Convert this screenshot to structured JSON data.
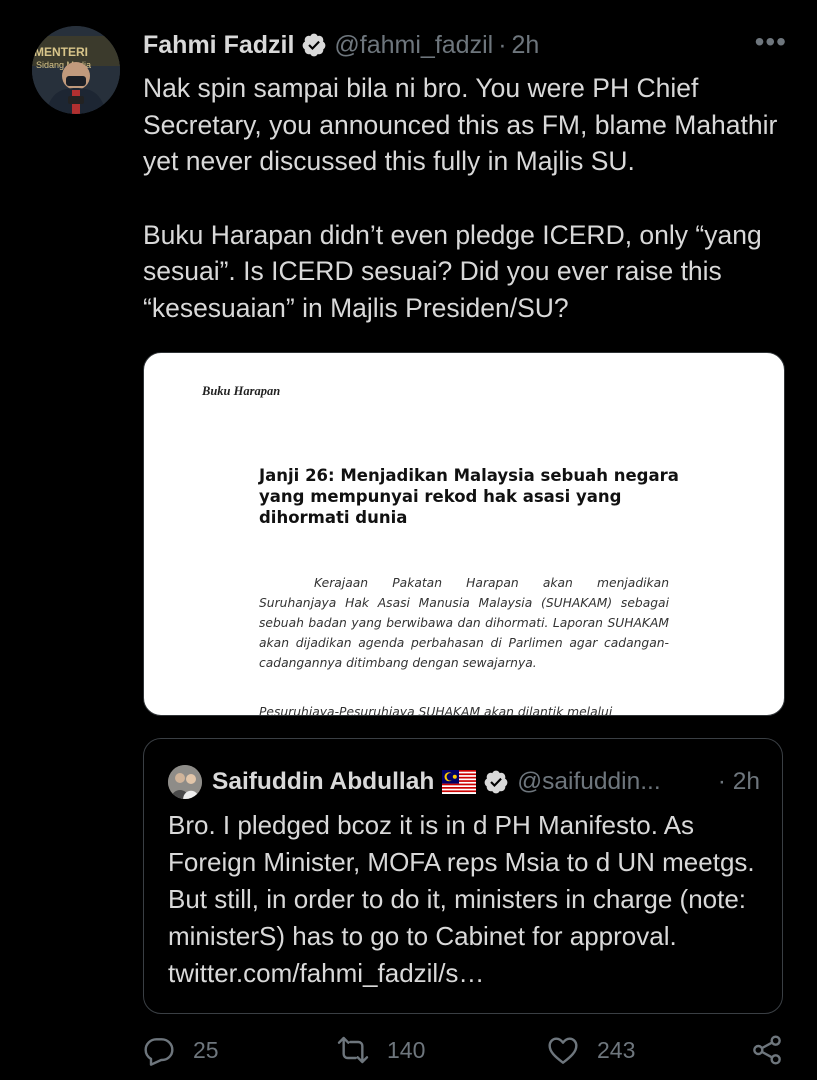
{
  "tweet": {
    "author_name": "Fahmi Fadzil",
    "handle": "@fahmi_fadzil",
    "separator": "·",
    "time": "2h",
    "more_label": "•••",
    "avatar_backdrop_text": "MENTERI",
    "avatar_backdrop_text2": "Sidang Media",
    "paragraphs": [
      "Nak spin sampai bila ni bro. You were PH Chief Secretary, you announced this as FM, blame Mahathir yet never discussed this fully in Majlis SU.",
      "Buku Harapan didn’t even pledge ICERD, only “yang sesuai”. Is ICERD sesuai? Did you ever raise this “kesesuaian” in Majlis Presiden/SU?"
    ]
  },
  "media": {
    "doc_label": "Buku Harapan",
    "heading": "Janji 26: Menjadikan Malaysia sebuah negara yang mempunyai rekod hak asasi yang dihormati dunia",
    "body": "Kerajaan Pakatan Harapan akan menjadikan Suruhanjaya Hak Asasi Manusia Malaysia (SUHAKAM) sebagai sebuah badan yang berwibawa dan dihormati. Laporan SUHAKAM akan dijadikan agenda perbahasan di Parlimen agar cadangan-cadangannya ditimbang dengan sewajarnya.",
    "cut_line": "Pesuruhjaya-Pesuruhjaya SUHAKAM akan dilantik melalui"
  },
  "quoted": {
    "author_name": "Saifuddin Abdullah",
    "handle": "@saifuddin...",
    "separator": "·",
    "time": "2h",
    "text": "Bro. I pledged bcoz it is in d PH Manifesto. As Foreign Minister, MOFA reps Msia to d UN meetgs. But still, in order to do it, ministers in charge (note: ministerS) has to go to Cabinet for approval. twitter.com/fahmi_fadzil/s…"
  },
  "actions": {
    "replies": "25",
    "retweets": "140",
    "likes": "243"
  },
  "icons": {
    "verified": "verified-badge-icon",
    "more": "more-icon",
    "reply": "reply-icon",
    "retweet": "retweet-icon",
    "like": "heart-icon",
    "share": "share-icon",
    "flag": "malaysia-flag-icon"
  },
  "colors": {
    "background": "#000000",
    "text": "#d9d9d9",
    "muted": "#6e767d",
    "border": "#2f3336"
  }
}
